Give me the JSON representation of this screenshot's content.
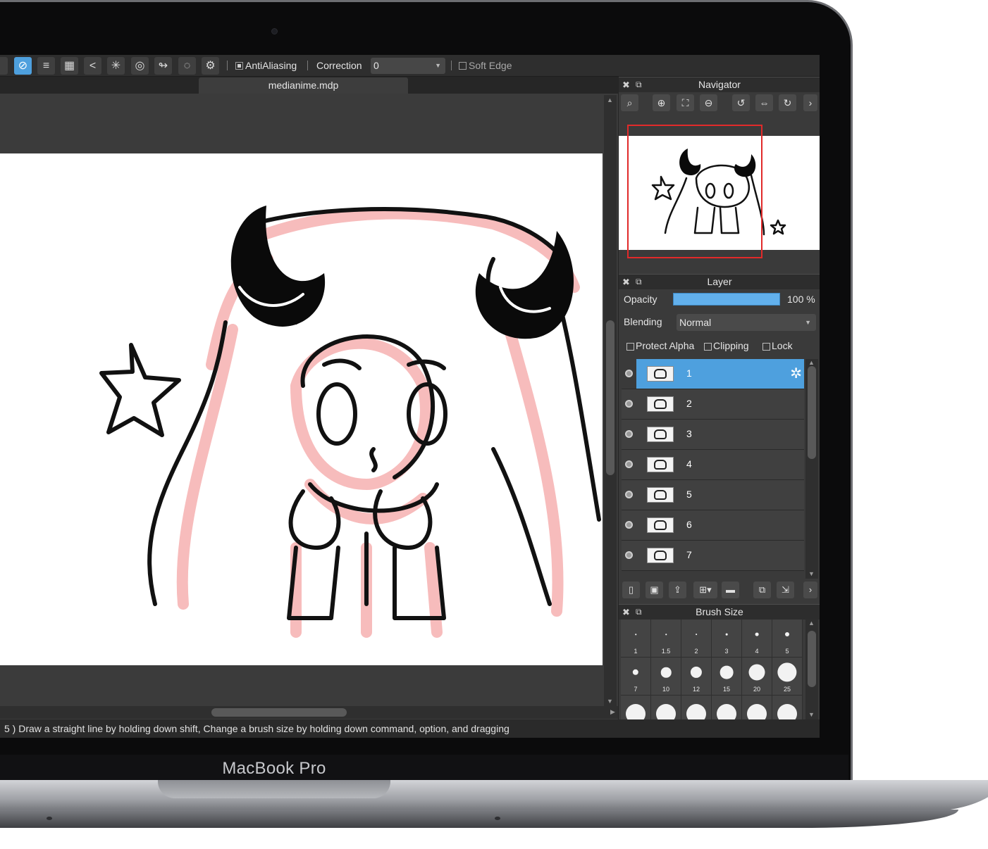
{
  "device": {
    "brand": "MacBook Pro"
  },
  "toolbar": {
    "antialiasing_label": "AntiAliasing",
    "correction_label": "Correction",
    "correction_value": "0",
    "soft_edge_label": "Soft Edge"
  },
  "document": {
    "tab_title": "medianime.mdp"
  },
  "status": {
    "text": "5 )   Draw a straight line by holding down shift, Change a brush size by holding down command, option, and dragging"
  },
  "navigator": {
    "title": "Navigator"
  },
  "layer_panel": {
    "title": "Layer",
    "opacity_label": "Opacity",
    "opacity_value": "100 %",
    "opacity_fraction": 1.0,
    "blending_label": "Blending",
    "blending_value": "Normal",
    "protect_alpha_label": "Protect Alpha",
    "clipping_label": "Clipping",
    "lock_label": "Lock",
    "layers": [
      {
        "name": "1",
        "selected": true
      },
      {
        "name": "2",
        "selected": false
      },
      {
        "name": "3",
        "selected": false
      },
      {
        "name": "4",
        "selected": false
      },
      {
        "name": "5",
        "selected": false
      },
      {
        "name": "6",
        "selected": false
      },
      {
        "name": "7",
        "selected": false
      }
    ]
  },
  "brush_panel": {
    "title": "Brush Size",
    "sizes": [
      "1",
      "1.5",
      "2",
      "3",
      "4",
      "5",
      "7",
      "10",
      "12",
      "15",
      "20",
      "25"
    ]
  },
  "colors": {
    "accent": "#4ea0de",
    "canvas": "#ffffff",
    "sketch_line": "#111111",
    "sketch_ghost": "#f7bcbc",
    "nav_frame": "#e12a2a"
  }
}
